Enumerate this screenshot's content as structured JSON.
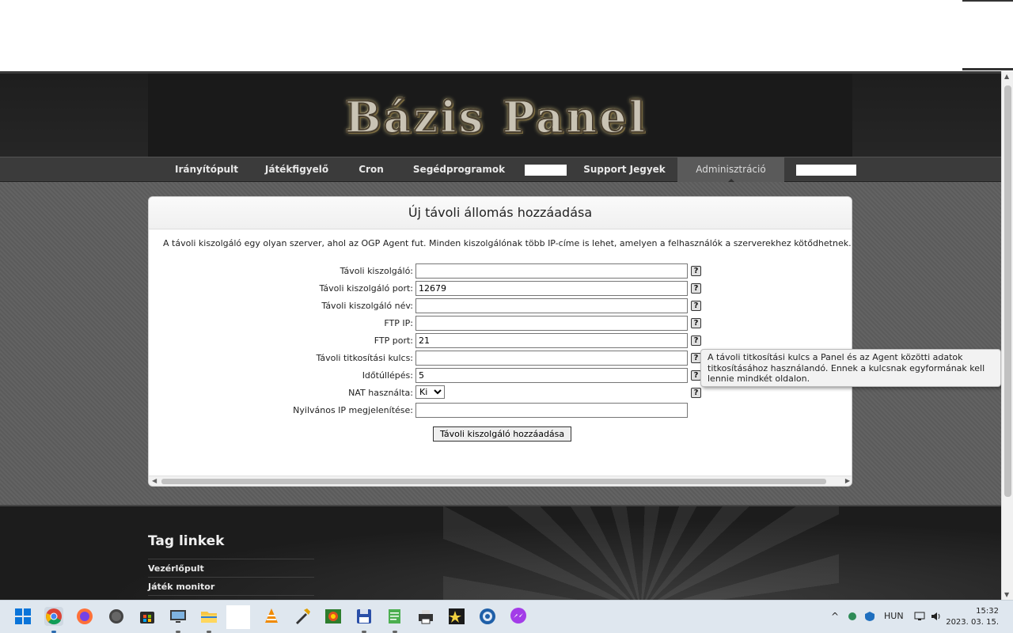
{
  "site": {
    "logo_text": "Bázis Panel"
  },
  "nav": {
    "items": [
      "Irányítópult",
      "Játékfigyelő",
      "Cron",
      "Segédprogramok",
      "Support Jegyek",
      "Adminisztráció"
    ],
    "active": "Adminisztráció"
  },
  "form": {
    "title": "Új távoli állomás hozzáadása",
    "intro": "A távoli kiszolgáló egy olyan szerver, ahol az OGP Agent fut. Minden kiszolgálónak több IP-címe is lehet, amelyen a felhasználók a szerverekhez kötődhetnek.",
    "fields": {
      "remote_host": {
        "label": "Távoli kiszolgáló:",
        "value": ""
      },
      "remote_port": {
        "label": "Távoli kiszolgáló port:",
        "value": "12679"
      },
      "remote_name": {
        "label": "Távoli kiszolgáló név:",
        "value": ""
      },
      "ftp_ip": {
        "label": "FTP IP:",
        "value": ""
      },
      "ftp_port": {
        "label": "FTP port:",
        "value": "21"
      },
      "encryption_key": {
        "label": "Távoli titkosítási kulcs:",
        "value": ""
      },
      "timeout": {
        "label": "Időtúllépés:",
        "value": "5"
      },
      "nat": {
        "label": "NAT használta:",
        "value": "Ki"
      },
      "public_ip": {
        "label": "Nyilvános IP megjelenítése:",
        "value": ""
      }
    },
    "help_glyph": "?",
    "submit_label": "Távoli kiszolgáló hozzáadása",
    "tooltip": "A távoli titkosítási kulcs a Panel és az Agent közötti adatok titkosításához használandó. Ennek a kulcsnak egyformának kell lennie mindkét oldalon."
  },
  "footer": {
    "heading": "Tag linkek",
    "links": [
      "Vezérlőpult",
      "Játék monitor"
    ]
  },
  "taskbar": {
    "language": "HUN",
    "time": "15:32",
    "date": "2023. 03. 15."
  }
}
